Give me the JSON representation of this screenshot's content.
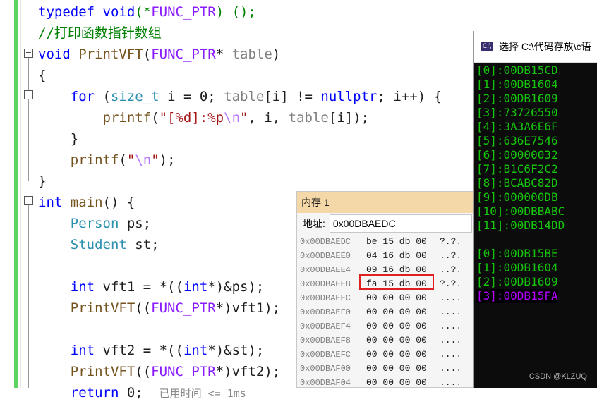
{
  "editor": {
    "lines": [
      "typedef void(*FUNC_PTR) ();",
      "//打印函数指针数组",
      "void PrintVFT(FUNC_PTR* table)",
      "{",
      "    for (size_t i = 0; table[i] != nullptr; i++) {",
      "        printf(\"[%d]:%p\\n\", i, table[i]);",
      "    }",
      "    printf(\"\\n\");",
      "}",
      "int main() {",
      "    Person ps;",
      "    Student st;",
      "",
      "    int vft1 = *((int*)&ps);",
      "    PrintVFT((FUNC_PTR*)vft1);",
      "",
      "    int vft2 = *((int*)&st);",
      "    PrintVFT((FUNC_PTR*)vft2);",
      "    return 0;  已用时间 <= 1ms"
    ]
  },
  "memory": {
    "title": "内存 1",
    "address_label": "地址:",
    "address_value": "0x00DBAEDC",
    "rows": [
      {
        "addr": "0x00DBAEDC",
        "bytes": "be 15 db 00",
        "chars": "?.?."
      },
      {
        "addr": "0x00DBAEE0",
        "bytes": "04 16 db 00",
        "chars": "..?."
      },
      {
        "addr": "0x00DBAEE4",
        "bytes": "09 16 db 00",
        "chars": "..?."
      },
      {
        "addr": "0x00DBAEE8",
        "bytes": "fa 15 db 00",
        "chars": "?.?."
      },
      {
        "addr": "0x00DBAEEC",
        "bytes": "00 00 00 00",
        "chars": "...."
      },
      {
        "addr": "0x00DBAEF0",
        "bytes": "00 00 00 00",
        "chars": "...."
      },
      {
        "addr": "0x00DBAEF4",
        "bytes": "00 00 00 00",
        "chars": "...."
      },
      {
        "addr": "0x00DBAEF8",
        "bytes": "00 00 00 00",
        "chars": "...."
      },
      {
        "addr": "0x00DBAEFC",
        "bytes": "00 00 00 00",
        "chars": "...."
      },
      {
        "addr": "0x00DBAF00",
        "bytes": "00 00 00 00",
        "chars": "...."
      },
      {
        "addr": "0x00DBAF04",
        "bytes": "00 00 00 00",
        "chars": "...."
      }
    ]
  },
  "console": {
    "title": "选择 C:\\代码存放\\c语",
    "icon": "console-icon",
    "lines": [
      "[0]:00DB15CD",
      "[1]:00DB1604",
      "[2]:00DB1609",
      "[3]:73726550",
      "[4]:3A3A6E6F",
      "[5]:636E7546",
      "[6]:00000032",
      "[7]:B1C6F2C2",
      "[8]:BCABC82D",
      "[9]:000000DB",
      "[10]:00DBBABC",
      "[11]:00DB14DD",
      "",
      "[0]:00DB15BE",
      "[1]:00DB1604",
      "[2]:00DB1609",
      "[3]:00DB15FA"
    ]
  },
  "watermark": "CSDN @KLZUQ",
  "colors": {
    "highlight": "#e02020",
    "console_text": "#16c60c",
    "console_selected": "#b400ff",
    "memory_title_bg": "#f5d8a8"
  }
}
